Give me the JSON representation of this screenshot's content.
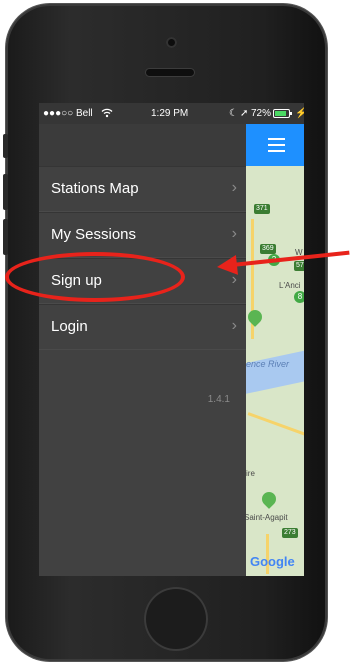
{
  "status_bar": {
    "carrier": "●●●○○ Bell",
    "wifi_icon": "wifi-icon",
    "time": "1:29 PM",
    "battery": "72%"
  },
  "menu": {
    "items": [
      {
        "label": "Stations Map"
      },
      {
        "label": "My Sessions"
      },
      {
        "label": "Sign up"
      },
      {
        "label": "Login"
      }
    ],
    "chevron": "›",
    "version": "1.4.1"
  },
  "map": {
    "labels": {
      "road_371": "371",
      "road_369": "369",
      "badge_2": "2",
      "road_57": "57",
      "lanc": "L'Anci",
      "badge_8": "8",
      "river": "ence River",
      "ire": "ire",
      "saint_agapit": "Saint-Agapit",
      "road_273": "273",
      "w": "W"
    },
    "attribution": "Google"
  },
  "colors": {
    "accent": "#1e90ff",
    "annotation": "#e8231b",
    "menu_bg": "#414141"
  }
}
